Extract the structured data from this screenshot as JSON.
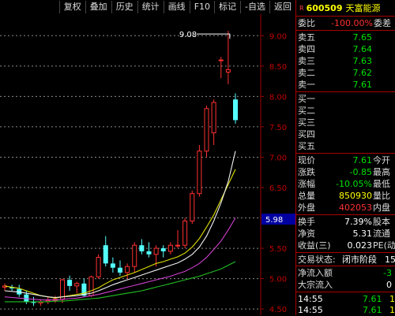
{
  "toolbar": {
    "items": [
      "复权",
      "叠加",
      "历史",
      "统计",
      "画线",
      "F10",
      "标记",
      "-自选",
      "返回"
    ]
  },
  "chart_data": {
    "type": "candlestick",
    "y_ticks": [
      "9.00",
      "8.50",
      "8.00",
      "7.50",
      "7.00",
      "6.50",
      "6.00",
      "5.50",
      "5.00",
      "4.50"
    ],
    "ylim": [
      4.45,
      9.25
    ],
    "current_price_marker": "5.98",
    "high_annotation": "9.08",
    "candles": [
      {
        "o": 4.86,
        "h": 4.92,
        "l": 4.8,
        "c": 4.88
      },
      {
        "o": 4.86,
        "h": 4.9,
        "l": 4.8,
        "c": 4.84
      },
      {
        "o": 4.83,
        "h": 4.9,
        "l": 4.7,
        "c": 4.74
      },
      {
        "o": 4.74,
        "h": 4.8,
        "l": 4.58,
        "c": 4.62
      },
      {
        "o": 4.62,
        "h": 4.7,
        "l": 4.55,
        "c": 4.6
      },
      {
        "o": 4.6,
        "h": 4.66,
        "l": 4.55,
        "c": 4.62
      },
      {
        "o": 4.62,
        "h": 4.7,
        "l": 4.58,
        "c": 4.64
      },
      {
        "o": 4.64,
        "h": 4.72,
        "l": 4.6,
        "c": 4.66
      },
      {
        "o": 4.66,
        "h": 5.0,
        "l": 4.6,
        "c": 4.98
      },
      {
        "o": 4.98,
        "h": 5.05,
        "l": 4.8,
        "c": 4.88
      },
      {
        "o": 4.88,
        "h": 4.95,
        "l": 4.76,
        "c": 4.92
      },
      {
        "o": 4.92,
        "h": 5.0,
        "l": 4.7,
        "c": 4.72
      },
      {
        "o": 4.72,
        "h": 5.05,
        "l": 4.7,
        "c": 5.03
      },
      {
        "o": 5.03,
        "h": 5.4,
        "l": 5.0,
        "c": 5.35
      },
      {
        "o": 5.55,
        "h": 5.7,
        "l": 5.2,
        "c": 5.25
      },
      {
        "o": 5.25,
        "h": 5.35,
        "l": 5.1,
        "c": 5.18
      },
      {
        "o": 5.18,
        "h": 5.3,
        "l": 5.05,
        "c": 5.1
      },
      {
        "o": 5.1,
        "h": 5.25,
        "l": 5.0,
        "c": 5.2
      },
      {
        "o": 5.2,
        "h": 5.6,
        "l": 5.1,
        "c": 5.55
      },
      {
        "o": 5.55,
        "h": 5.65,
        "l": 5.4,
        "c": 5.45
      },
      {
        "o": 5.45,
        "h": 5.6,
        "l": 5.35,
        "c": 5.4
      },
      {
        "o": 5.4,
        "h": 5.55,
        "l": 5.2,
        "c": 5.5
      },
      {
        "o": 5.5,
        "h": 5.55,
        "l": 5.35,
        "c": 5.45
      },
      {
        "o": 5.45,
        "h": 5.6,
        "l": 5.4,
        "c": 5.55
      },
      {
        "o": 5.55,
        "h": 5.8,
        "l": 5.5,
        "c": 5.55
      },
      {
        "o": 5.55,
        "h": 6.0,
        "l": 5.5,
        "c": 5.95
      },
      {
        "o": 5.95,
        "h": 6.45,
        "l": 5.9,
        "c": 6.4
      },
      {
        "o": 6.4,
        "h": 7.2,
        "l": 6.35,
        "c": 7.1
      },
      {
        "o": 7.1,
        "h": 7.85,
        "l": 7.0,
        "c": 7.8
      },
      {
        "o": 7.4,
        "h": 7.95,
        "l": 7.2,
        "c": 7.9
      },
      {
        "o": 8.6,
        "h": 8.65,
        "l": 8.3,
        "c": 8.6
      },
      {
        "o": 8.4,
        "h": 9.08,
        "l": 8.2,
        "c": 8.44
      },
      {
        "o": 7.95,
        "h": 8.05,
        "l": 7.55,
        "c": 7.61
      }
    ],
    "ma_yellow": [
      4.88,
      4.86,
      4.84,
      4.8,
      4.76,
      4.72,
      4.7,
      4.68,
      4.7,
      4.72,
      4.74,
      4.76,
      4.8,
      4.85,
      4.92,
      4.98,
      5.02,
      5.06,
      5.1,
      5.15,
      5.2,
      5.25,
      5.28,
      5.32,
      5.36,
      5.42,
      5.52,
      5.66,
      5.85,
      6.05,
      6.3,
      6.55,
      6.8
    ],
    "ma_white": [
      4.8,
      4.79,
      4.78,
      4.76,
      4.74,
      4.72,
      4.7,
      4.69,
      4.7,
      4.71,
      4.72,
      4.74,
      4.76,
      4.8,
      4.85,
      4.9,
      4.94,
      4.98,
      5.02,
      5.06,
      5.1,
      5.14,
      5.18,
      5.22,
      5.26,
      5.32,
      5.4,
      5.52,
      5.7,
      5.95,
      6.25,
      6.6,
      7.1
    ],
    "ma_magenta": [
      4.7,
      4.69,
      4.68,
      4.67,
      4.66,
      4.65,
      4.65,
      4.65,
      4.66,
      4.67,
      4.68,
      4.7,
      4.72,
      4.74,
      4.77,
      4.8,
      4.83,
      4.86,
      4.89,
      4.92,
      4.95,
      4.98,
      5.01,
      5.04,
      5.08,
      5.12,
      5.18,
      5.25,
      5.35,
      5.48,
      5.62,
      5.8,
      6.0
    ],
    "ma_green": [
      4.62,
      4.62,
      4.62,
      4.62,
      4.62,
      4.62,
      4.62,
      4.63,
      4.63,
      4.64,
      4.65,
      4.66,
      4.67,
      4.68,
      4.7,
      4.72,
      4.74,
      4.76,
      4.78,
      4.8,
      4.83,
      4.86,
      4.89,
      4.92,
      4.95,
      4.98,
      5.01,
      5.04,
      5.08,
      5.12,
      5.16,
      5.22,
      5.28
    ]
  },
  "quote": {
    "badge": "R",
    "code": "600509",
    "name": "天富能源",
    "wb_label": "委比",
    "wb_value": "-100.00%",
    "wc_label": "委差",
    "sells": [
      {
        "label": "卖五",
        "price": "7.65"
      },
      {
        "label": "卖四",
        "price": "7.64"
      },
      {
        "label": "卖三",
        "price": "7.63"
      },
      {
        "label": "卖二",
        "price": "7.62"
      },
      {
        "label": "卖一",
        "price": "7.61"
      }
    ],
    "buys": [
      {
        "label": "买一"
      },
      {
        "label": "买二"
      },
      {
        "label": "买三"
      },
      {
        "label": "买四"
      },
      {
        "label": "买五"
      }
    ],
    "stats": [
      {
        "l": "现价",
        "v": "7.61",
        "r": "今开",
        "cls": "green"
      },
      {
        "l": "涨跌",
        "v": "-0.85",
        "r": "最高",
        "cls": "green"
      },
      {
        "l": "涨幅",
        "v": "-10.05%",
        "r": "最低",
        "cls": "green"
      },
      {
        "l": "总量",
        "v": "850930",
        "r": "量比",
        "cls": "yellow"
      },
      {
        "l": "外盘",
        "v": "402053",
        "r": "内盘",
        "cls": "red"
      }
    ],
    "extra": [
      {
        "l": "换手",
        "v": "7.39%",
        "r": "股本"
      },
      {
        "l": "净资",
        "v": "5.31",
        "r": "流通"
      },
      {
        "l": "收益(三)",
        "v": "0.023",
        "r": "PE(动"
      }
    ],
    "status_label": "交易状态:",
    "status_value": "闭市阶段",
    "status_tail": "15",
    "net_in_label": "净流入额",
    "net_in_value": "-3",
    "bulk_label": "大宗流入",
    "bulk_value": "0",
    "ticks": [
      {
        "t": "14:55",
        "p": "7.61",
        "n": "1"
      },
      {
        "t": "14:55",
        "p": "7.61",
        "n": "1"
      }
    ]
  }
}
